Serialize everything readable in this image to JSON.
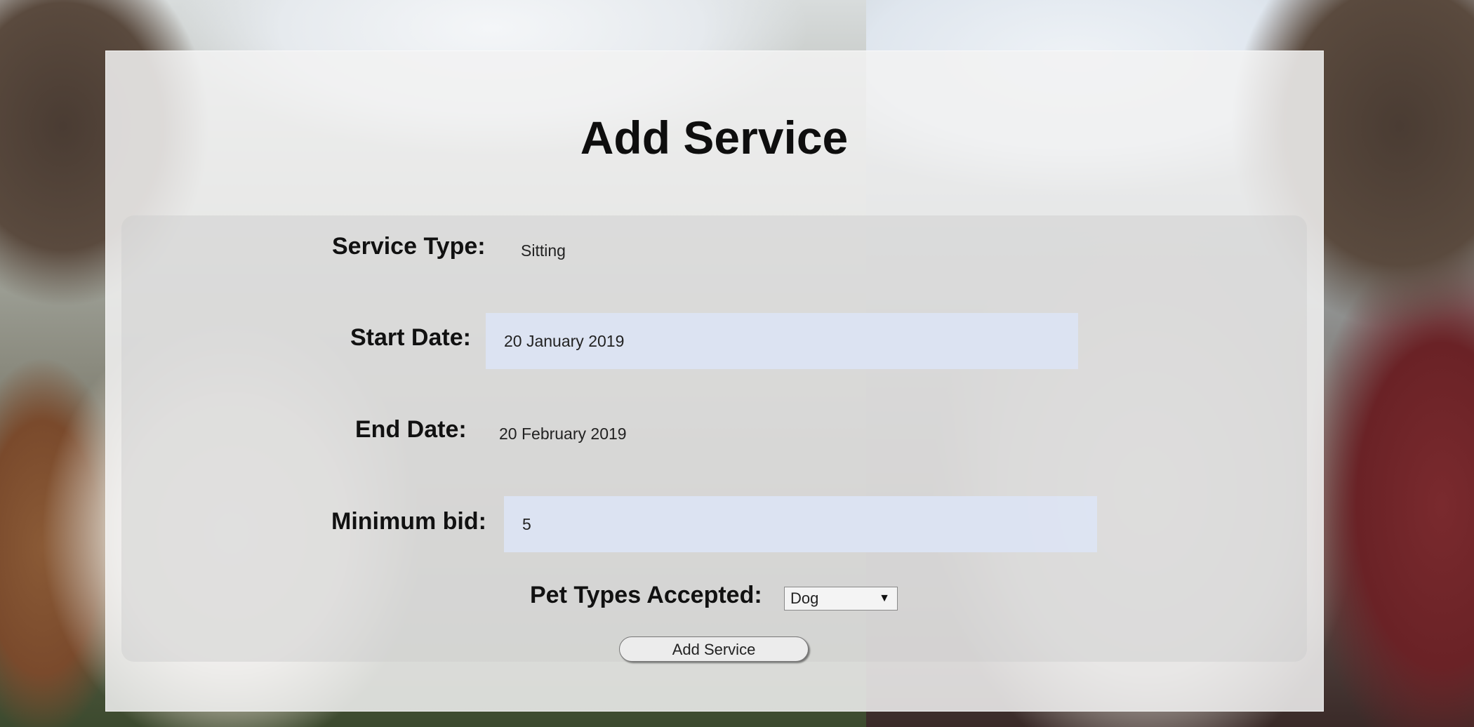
{
  "page": {
    "title": "Add Service"
  },
  "form": {
    "service_type": {
      "label": "Service Type:",
      "value": "Sitting"
    },
    "start_date": {
      "label": "Start Date:",
      "value": "20 January 2019"
    },
    "end_date": {
      "label": "End Date:",
      "value": "20 February 2019"
    },
    "minimum_bid": {
      "label": "Minimum bid:",
      "value": "5"
    },
    "pet_types": {
      "label": "Pet Types Accepted:",
      "selected": "Dog"
    },
    "submit_label": "Add Service"
  }
}
